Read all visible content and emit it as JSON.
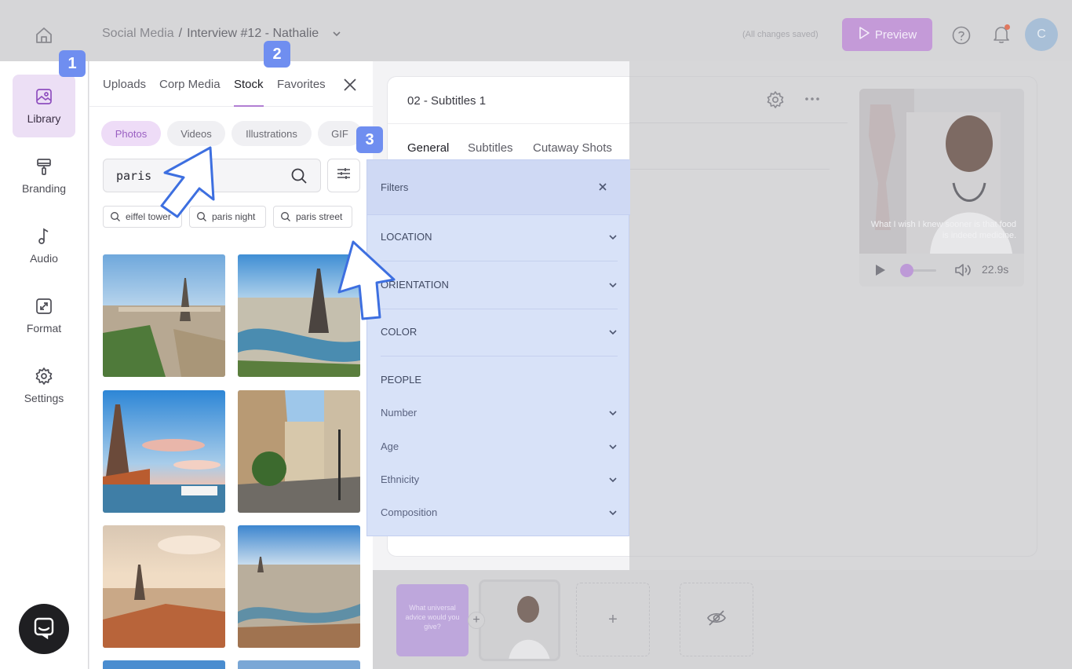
{
  "topbar": {
    "breadcrumb_project": "Social Media",
    "breadcrumb_sep": "/",
    "breadcrumb_doc": "Interview #12 - Nathalie",
    "saved_status": "(All changes saved)",
    "preview_label": "Preview",
    "avatar_initial": "C"
  },
  "sidebar": {
    "items": [
      {
        "label": "Library",
        "icon": "image-icon"
      },
      {
        "label": "Branding",
        "icon": "paint-roller-icon"
      },
      {
        "label": "Audio",
        "icon": "music-note-icon"
      },
      {
        "label": "Format",
        "icon": "resize-icon"
      },
      {
        "label": "Settings",
        "icon": "gear-icon"
      }
    ]
  },
  "library": {
    "tabs": [
      "Uploads",
      "Corp Media",
      "Stock",
      "Favorites"
    ],
    "active_tab": "Stock",
    "chips": [
      "Photos",
      "Videos",
      "Illustrations",
      "GIF"
    ],
    "active_chip": "Photos",
    "search_value": "paris",
    "suggestions": [
      "eiffel tower",
      "paris night",
      "paris street"
    ]
  },
  "editor": {
    "title": "02 - Subtitles 1",
    "tabs": [
      "General",
      "Subtitles",
      "Cutaway Shots"
    ],
    "active_tab": "General"
  },
  "video": {
    "subtitle": "What I wish I knew sooner is that food is indeed medicine.",
    "duration": "22.9s"
  },
  "scenes": {
    "question": "What universal advice would you give?",
    "add_label": "+"
  },
  "filters": {
    "title": "Filters",
    "sections": [
      "LOCATION",
      "ORIENTATION",
      "COLOR"
    ],
    "people_heading": "PEOPLE",
    "people_rows": [
      "Number",
      "Age",
      "Ethnicity",
      "Composition"
    ]
  },
  "badges": [
    "1",
    "2",
    "3"
  ],
  "colors": {
    "accent_purple": "#b17fd3",
    "badge_blue": "#6f8ef0",
    "filters_bg": "#d8e2f8"
  }
}
